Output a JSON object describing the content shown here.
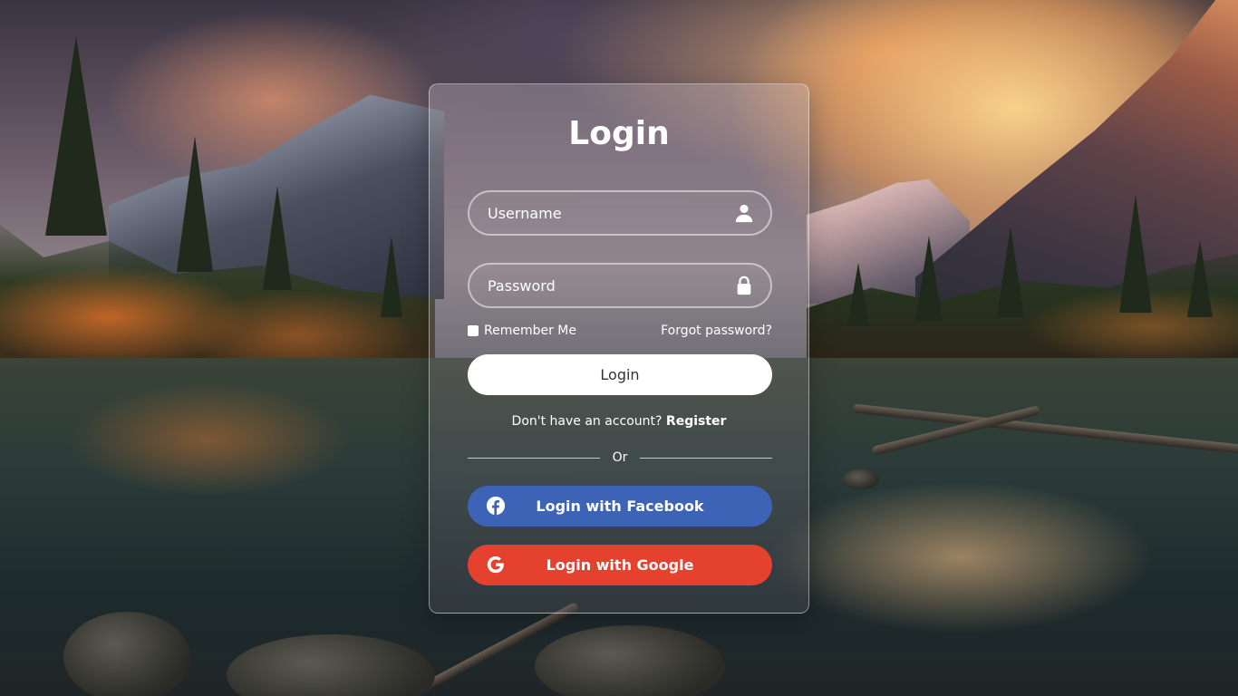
{
  "form": {
    "title": "Login",
    "username_placeholder": "Username",
    "password_placeholder": "Password",
    "remember_label": "Remember Me",
    "forgot_label": "Forgot password?",
    "login_button": "Login",
    "no_account_text": "Don't have an account?",
    "register_link": "Register",
    "divider_text": "Or",
    "facebook_button": "Login with Facebook",
    "google_button": "Login with Google"
  },
  "icons": {
    "username": "user-icon",
    "password": "lock-icon",
    "facebook": "facebook-icon",
    "google": "google-icon"
  },
  "colors": {
    "facebook": "#3d63b6",
    "google": "#e4412f",
    "login_button_bg": "#ffffff"
  }
}
